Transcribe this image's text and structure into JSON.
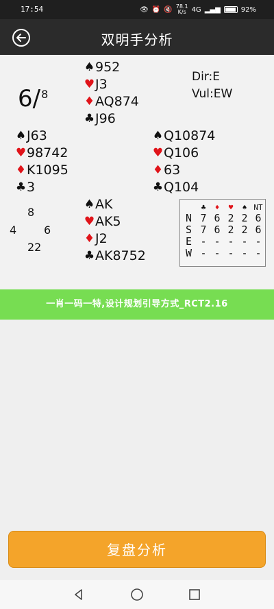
{
  "status_bar": {
    "time": "17:54",
    "speed_value": "78.1",
    "speed_unit": "K/s",
    "network": "4G",
    "battery": "92%"
  },
  "header": {
    "title": "双明手分析"
  },
  "contract": {
    "level": "6/",
    "number": "8"
  },
  "info": {
    "dir": "Dir:E",
    "vul": "Vul:EW"
  },
  "hands": {
    "north": {
      "spades": "952",
      "hearts": "J3",
      "diamonds": "AQ874",
      "clubs": "J96"
    },
    "west": {
      "spades": "J63",
      "hearts": "98742",
      "diamonds": "K1095",
      "clubs": "3"
    },
    "east": {
      "spades": "Q10874",
      "hearts": "Q106",
      "diamonds": "63",
      "clubs": "Q104"
    },
    "south": {
      "spades": "AK",
      "hearts": "AK5",
      "diamonds": "J2",
      "clubs": "AK8752"
    }
  },
  "hcp": {
    "north": "8",
    "west": "4",
    "east": "6",
    "south": "22"
  },
  "tricks_table": {
    "header_nt": "NT",
    "rows": [
      {
        "dir": "N",
        "values": [
          "7",
          "6",
          "2",
          "2",
          "6"
        ]
      },
      {
        "dir": "S",
        "values": [
          "7",
          "6",
          "2",
          "2",
          "6"
        ]
      },
      {
        "dir": "E",
        "values": [
          "-",
          "-",
          "-",
          "-",
          "-"
        ]
      },
      {
        "dir": "W",
        "values": [
          "-",
          "-",
          "-",
          "-",
          "-"
        ]
      }
    ]
  },
  "banner": {
    "text": "一肖一码一特,设计规划引导方式_RCT2.16"
  },
  "replay_button": {
    "label": "复盘分析"
  },
  "colors": {
    "accent": "#f4a42a",
    "banner": "#77dd52",
    "header": "#2b2b2b",
    "red_suit": "#e0141a"
  }
}
